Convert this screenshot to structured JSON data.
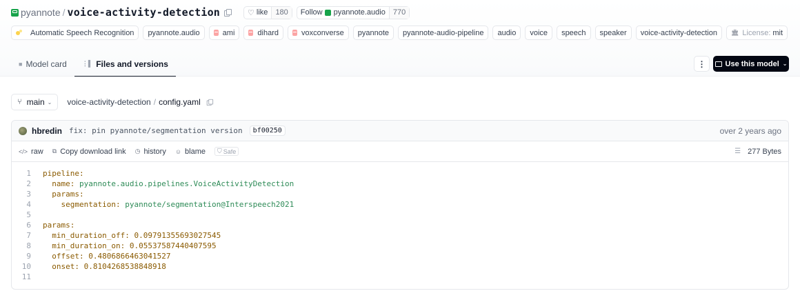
{
  "repo": {
    "owner": "pyannote",
    "name": "voice-activity-detection",
    "like_label": "like",
    "like_count": "180",
    "follow_label": "Follow",
    "follow_org": "pyannote.audio",
    "follow_count": "770"
  },
  "tags": [
    {
      "label": "Automatic Speech Recognition",
      "icon": "task-icon"
    },
    {
      "label": "pyannote.audio",
      "icon": ""
    },
    {
      "label": "ami",
      "icon": "dataset-icon"
    },
    {
      "label": "dihard",
      "icon": "dataset-icon"
    },
    {
      "label": "voxconverse",
      "icon": "dataset-icon"
    },
    {
      "label": "pyannote",
      "icon": ""
    },
    {
      "label": "pyannote-audio-pipeline",
      "icon": ""
    },
    {
      "label": "audio",
      "icon": ""
    },
    {
      "label": "voice",
      "icon": ""
    },
    {
      "label": "speech",
      "icon": ""
    },
    {
      "label": "speaker",
      "icon": ""
    },
    {
      "label": "voice-activity-detection",
      "icon": ""
    }
  ],
  "license": {
    "label": "License:",
    "value": "mit"
  },
  "tabs": [
    {
      "label": "Model card",
      "active": false
    },
    {
      "label": "Files and versions",
      "active": true
    }
  ],
  "use_model_label": "Use this model",
  "path": {
    "branch": "main",
    "folder": "voice-activity-detection",
    "separator": "/",
    "file": "config.yaml"
  },
  "commit": {
    "author": "hbredin",
    "message": "fix: pin pyannote/segmentation version",
    "sha": "bf00250",
    "time": "over 2 years ago"
  },
  "actions": {
    "raw": "raw",
    "copy_link": "Copy download link",
    "history": "history",
    "blame": "blame",
    "safe": "Safe",
    "size": "277 Bytes"
  },
  "code": [
    {
      "n": "1",
      "indent": "",
      "key": "pipeline:",
      "val": "",
      "vtype": ""
    },
    {
      "n": "2",
      "indent": "  ",
      "key": "name:",
      "val": " pyannote.audio.pipelines.VoiceActivityDetection",
      "vtype": "s"
    },
    {
      "n": "3",
      "indent": "  ",
      "key": "params:",
      "val": "",
      "vtype": ""
    },
    {
      "n": "4",
      "indent": "    ",
      "key": "segmentation:",
      "val": " pyannote/segmentation@Interspeech2021",
      "vtype": "s"
    },
    {
      "n": "5",
      "indent": "",
      "key": "",
      "val": "",
      "vtype": ""
    },
    {
      "n": "6",
      "indent": "",
      "key": "params:",
      "val": "",
      "vtype": ""
    },
    {
      "n": "7",
      "indent": "  ",
      "key": "min_duration_off:",
      "val": " 0.09791355693027545",
      "vtype": "n"
    },
    {
      "n": "8",
      "indent": "  ",
      "key": "min_duration_on:",
      "val": " 0.05537587440407595",
      "vtype": "n"
    },
    {
      "n": "9",
      "indent": "  ",
      "key": "offset:",
      "val": " 0.4806866463041527",
      "vtype": "n"
    },
    {
      "n": "10",
      "indent": "  ",
      "key": "onset:",
      "val": " 0.8104268538848918",
      "vtype": "n"
    },
    {
      "n": "11",
      "indent": "",
      "key": "",
      "val": "",
      "vtype": ""
    }
  ]
}
